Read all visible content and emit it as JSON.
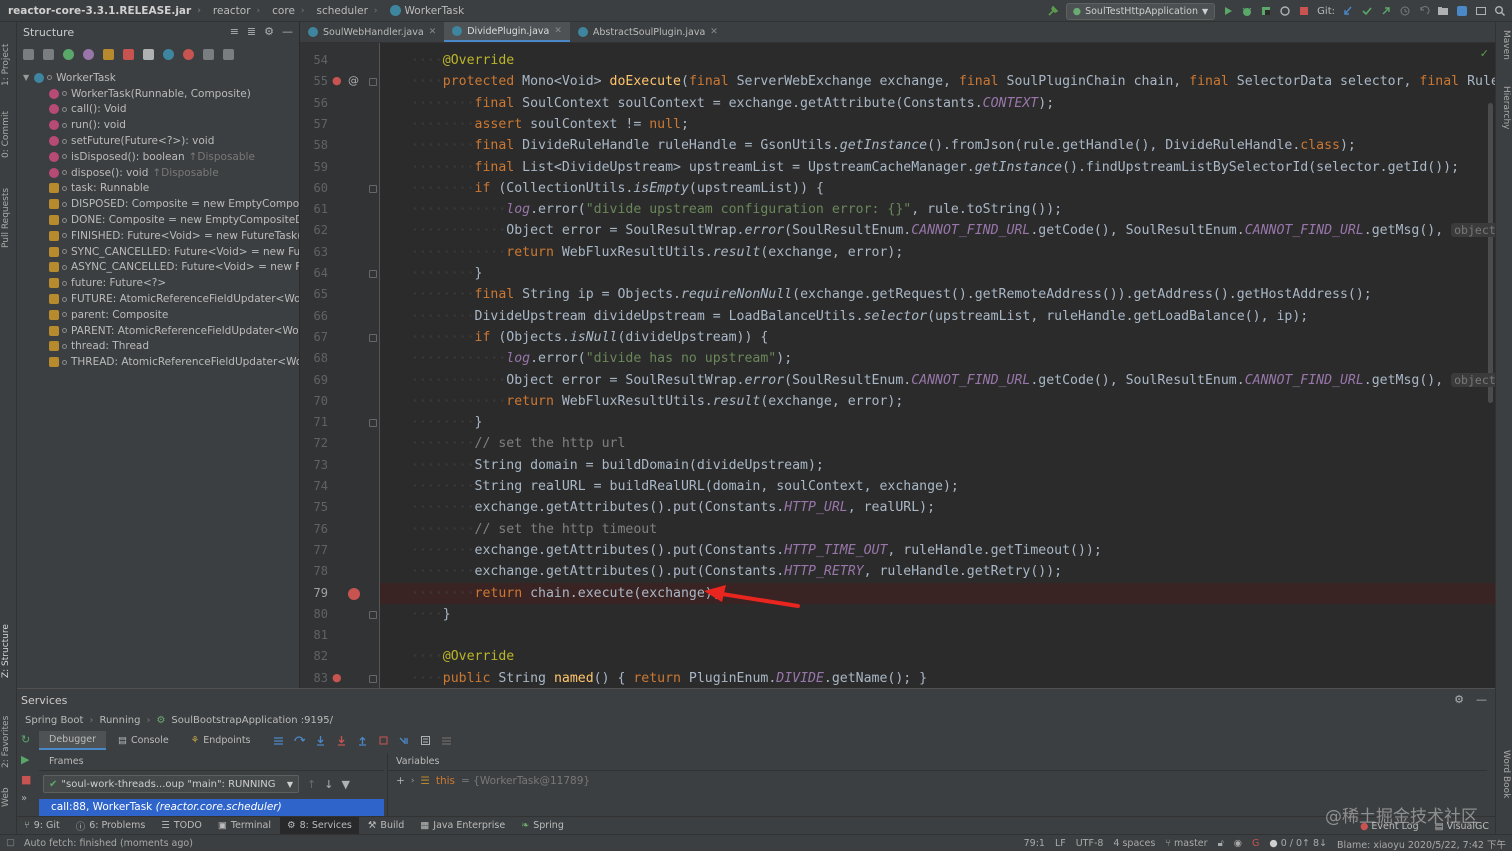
{
  "navbar": {
    "crumbs": [
      "reactor-core-3.3.1.RELEASE.jar",
      "reactor",
      "core",
      "scheduler",
      "WorkerTask"
    ],
    "run_config": "SoulTestHttpApplication",
    "git_label": "Git:"
  },
  "left_tabs": {
    "project": "1: Project",
    "commit": "0: Commit",
    "pull_requests": "Pull Requests",
    "structure": "Z: Structure",
    "favorites": "2: Favorites",
    "web": "Web"
  },
  "right_tabs": {
    "maven": "Maven",
    "hierarchy": "Hierarchy",
    "word_book": "Word Book"
  },
  "structure": {
    "title": "Structure",
    "root": "WorkerTask",
    "items": [
      {
        "kind": "m",
        "text": "WorkerTask(Runnable, Composite)",
        "hint": ""
      },
      {
        "kind": "m",
        "text": "call(): Void",
        "hint": ""
      },
      {
        "kind": "m",
        "text": "run(): void",
        "hint": ""
      },
      {
        "kind": "m",
        "text": "setFuture(Future<?>): void",
        "hint": ""
      },
      {
        "kind": "m",
        "text": "isDisposed(): boolean",
        "hint": "↑Disposable"
      },
      {
        "kind": "m",
        "text": "dispose(): void",
        "hint": "↑Disposable"
      },
      {
        "kind": "f",
        "text": "task: Runnable",
        "hint": ""
      },
      {
        "kind": "f",
        "text": "DISPOSED: Composite = new EmptyCompos",
        "hint": ""
      },
      {
        "kind": "f",
        "text": "DONE: Composite = new EmptyCompositeDi",
        "hint": ""
      },
      {
        "kind": "f",
        "text": "FINISHED: Future<Void> = new FutureTask(..",
        "hint": ""
      },
      {
        "kind": "f",
        "text": "SYNC_CANCELLED: Future<Void> = new Fut",
        "hint": ""
      },
      {
        "kind": "f",
        "text": "ASYNC_CANCELLED: Future<Void> = new Fu",
        "hint": ""
      },
      {
        "kind": "f",
        "text": "future: Future<?>",
        "hint": ""
      },
      {
        "kind": "f",
        "text": "FUTURE: AtomicReferenceFieldUpdater<Wor",
        "hint": ""
      },
      {
        "kind": "f",
        "text": "parent: Composite",
        "hint": ""
      },
      {
        "kind": "f",
        "text": "PARENT: AtomicReferenceFieldUpdater<Wor",
        "hint": ""
      },
      {
        "kind": "f",
        "text": "thread: Thread",
        "hint": ""
      },
      {
        "kind": "f",
        "text": "THREAD: AtomicReferenceFieldUpdater<Wo",
        "hint": ""
      }
    ]
  },
  "editor_tabs": [
    {
      "label": "SoulWebHandler.java",
      "active": false
    },
    {
      "label": "DividePlugin.java",
      "active": true
    },
    {
      "label": "AbstractSoulPlugin.java",
      "active": false
    }
  ],
  "editor": {
    "current_line": "79",
    "lines": [
      {
        "n": "54",
        "html": "    <span class=\"ann\">@Override</span>"
      },
      {
        "n": "55",
        "html": "    <span class=\"kw\">protected</span> Mono&lt;Void&gt; <span class=\"fn\">doExecute</span>(<span class=\"kw\">final</span> ServerWebExchange exchange, <span class=\"kw\">final</span> SoulPluginChain chain, <span class=\"kw\">final</span> SelectorData selector, <span class=\"kw\">final</span> RuleData"
      },
      {
        "n": "56",
        "html": "        <span class=\"kw\">final</span> SoulContext soulContext = exchange.getAttribute(Constants.<span class=\"cst\">CONTEXT</span>);"
      },
      {
        "n": "57",
        "html": "        <span class=\"kw\">assert</span> soulContext != <span class=\"kw\">null</span>;"
      },
      {
        "n": "58",
        "html": "        <span class=\"kw\">final</span> DivideRuleHandle ruleHandle = GsonUtils.<span class=\"it\">getInstance</span>().fromJson(rule.getHandle(), DivideRuleHandle.<span class=\"kw\">class</span>);"
      },
      {
        "n": "59",
        "html": "        <span class=\"kw\">final</span> List&lt;DivideUpstream&gt; upstreamList = UpstreamCacheManager.<span class=\"it\">getInstance</span>().findUpstreamListBySelectorId(selector.getId());"
      },
      {
        "n": "60",
        "html": "        <span class=\"kw\">if</span> (CollectionUtils.<span class=\"it\">isEmpty</span>(upstreamList)) {"
      },
      {
        "n": "61",
        "html": "            <span class=\"cst\">log</span>.error(<span class=\"str\">\"divide upstream configuration error: {}\"</span>, rule.toString());"
      },
      {
        "n": "62",
        "html": "            Object error = SoulResultWrap.<span class=\"it\">error</span>(SoulResultEnum.<span class=\"cst\">CANNOT_FIND_URL</span>.getCode(), SoulResultEnum.<span class=\"cst\">CANNOT_FIND_URL</span>.getMsg(), <span class=\"hintp\">object:</span> <span class=\"kw\">null</span>"
      },
      {
        "n": "63",
        "html": "            <span class=\"kw\">return</span> WebFluxResultUtils.<span class=\"it\">result</span>(exchange, error);"
      },
      {
        "n": "64",
        "html": "        }"
      },
      {
        "n": "65",
        "html": "        <span class=\"kw\">final</span> String ip = Objects.<span class=\"it\">requireNonNull</span>(exchange.getRequest().getRemoteAddress()).getAddress().getHostAddress();"
      },
      {
        "n": "66",
        "html": "        DivideUpstream divideUpstream = LoadBalanceUtils.<span class=\"it\">selector</span>(upstreamList, ruleHandle.getLoadBalance(), ip);"
      },
      {
        "n": "67",
        "html": "        <span class=\"kw\">if</span> (Objects.<span class=\"it\">isNull</span>(divideUpstream)) {"
      },
      {
        "n": "68",
        "html": "            <span class=\"cst\">log</span>.error(<span class=\"str\">\"divide has no upstream\"</span>);"
      },
      {
        "n": "69",
        "html": "            Object error = SoulResultWrap.<span class=\"it\">error</span>(SoulResultEnum.<span class=\"cst\">CANNOT_FIND_URL</span>.getCode(), SoulResultEnum.<span class=\"cst\">CANNOT_FIND_URL</span>.getMsg(), <span class=\"hintp\">object:</span> <span class=\"kw\">null</span>"
      },
      {
        "n": "70",
        "html": "            <span class=\"kw\">return</span> WebFluxResultUtils.<span class=\"it\">result</span>(exchange, error);"
      },
      {
        "n": "71",
        "html": "        }"
      },
      {
        "n": "72",
        "html": "        <span class=\"cmt\">// set the http url</span>"
      },
      {
        "n": "73",
        "html": "        String domain = buildDomain(divideUpstream);"
      },
      {
        "n": "74",
        "html": "        String realURL = buildRealURL(domain, soulContext, exchange);"
      },
      {
        "n": "75",
        "html": "        exchange.getAttributes().put(Constants.<span class=\"cst\">HTTP_URL</span>, realURL);"
      },
      {
        "n": "76",
        "html": "        <span class=\"cmt\">// set the http timeout</span>"
      },
      {
        "n": "77",
        "html": "        exchange.getAttributes().put(Constants.<span class=\"cst\">HTTP_TIME_OUT</span>, ruleHandle.getTimeout());"
      },
      {
        "n": "78",
        "html": "        exchange.getAttributes().put(Constants.<span class=\"cst\">HTTP_RETRY</span>, ruleHandle.getRetry());"
      },
      {
        "n": "79",
        "html": "        <span class=\"kw\">return</span> chain.execute(exchange);"
      },
      {
        "n": "80",
        "html": "    }"
      },
      {
        "n": "81",
        "html": ""
      },
      {
        "n": "82",
        "html": "    <span class=\"ann\">@Override</span>"
      },
      {
        "n": "83",
        "html": "    <span class=\"kw\">public</span> String <span class=\"fn\">named</span>() { <span class=\"kw\">return</span> PluginEnum.<span class=\"cst\">DIVIDE</span>.getName(); }"
      }
    ]
  },
  "services": {
    "title": "Services",
    "crumbs": [
      "Spring Boot",
      "Running",
      "SoulBootstrapApplication :9195/"
    ],
    "tabs": [
      "Debugger",
      "Console",
      "Endpoints"
    ],
    "frames_label": "Frames",
    "thread": "\"soul-work-threads...oup \"main\": RUNNING",
    "frame_method": "call:88, WorkerTask",
    "frame_package": "(reactor.core.scheduler)",
    "variables_label": "Variables",
    "var_name": "this",
    "var_value": "= {WorkerTask@11789}"
  },
  "bottom_tabs": [
    "9: Git",
    "6: Problems",
    "TODO",
    "Terminal",
    "8: Services",
    "Build",
    "Java Enterprise",
    "Spring"
  ],
  "bottom_right": {
    "event_log": "Event Log",
    "visualgc": "VisualGC"
  },
  "status": {
    "message": "Auto fetch: finished (moments ago)",
    "position": "79:1",
    "line_sep": "LF",
    "encoding": "UTF-8",
    "indent": "4 spaces",
    "branch": "master",
    "vcs_sync": "0 / 0↑ 8↓",
    "blame": "Blame: xiaoyu 2020/5/22, 7:42 下午"
  },
  "watermark": "@稀土掘金技术社区",
  "colors": {
    "accent": "#4a88c7",
    "selection": "#2f65ca",
    "breakpoint": "#c75450",
    "arrow": "#e8261f"
  }
}
